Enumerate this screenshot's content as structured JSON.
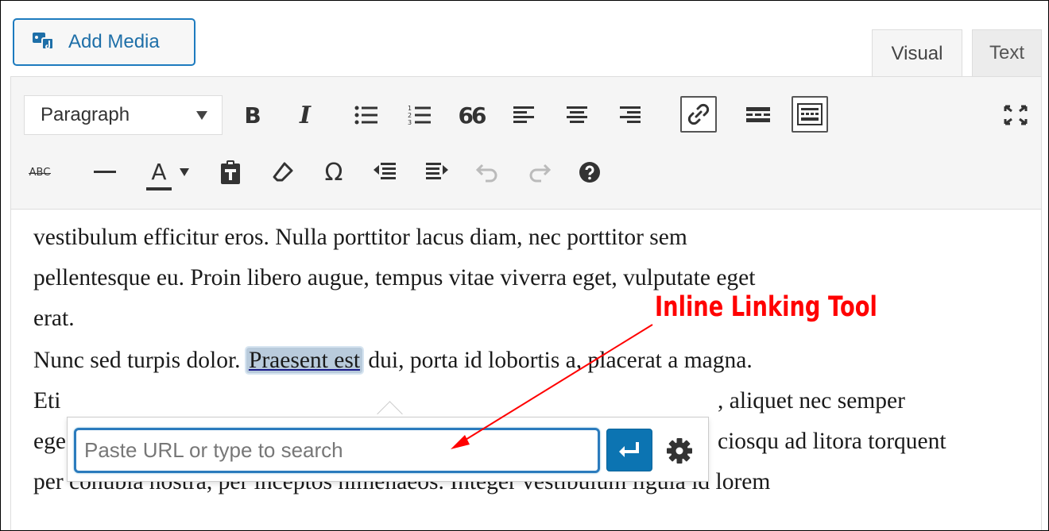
{
  "editor": {
    "add_media_label": "Add Media",
    "tabs": [
      {
        "label": "Visual",
        "active": true
      },
      {
        "label": "Text",
        "active": false
      }
    ]
  },
  "toolbar": {
    "format_select_value": "Paragraph",
    "row1_icons": [
      "bold-icon",
      "italic-icon",
      "bulleted-list-icon",
      "numbered-list-icon",
      "blockquote-icon",
      "align-left-icon",
      "align-center-icon",
      "align-right-icon",
      "insert-link-icon",
      "read-more-icon",
      "toolbar-toggle-icon",
      "fullscreen-icon"
    ],
    "row2_icons": [
      "strikethrough-icon",
      "horizontal-line-icon",
      "text-color-icon",
      "paste-as-text-icon",
      "clear-formatting-icon",
      "special-character-icon",
      "decrease-indent-icon",
      "increase-indent-icon",
      "undo-icon",
      "redo-icon",
      "help-icon"
    ],
    "bold_glyph": "B",
    "italic_glyph": "I",
    "blockquote_glyph": "66",
    "text_color_glyph": "A",
    "special_char_glyph": "Ω",
    "strike_glyph": "ABC"
  },
  "content": {
    "paragraph1_lines": [
      "vestibulum efficitur eros. Nulla porttitor lacus diam, nec porttitor sem",
      "pellentesque eu. Proin libero augue, tempus vitae viverra eget, vulputate eget",
      "erat."
    ],
    "paragraph2": {
      "line1_before": "Nunc sed turpis dolor. ",
      "line1_selected": "Praesent est",
      "line1_after": " dui, porta id lobortis a, placerat a magna.",
      "line2_start": "Eti",
      "line2_end": ", aliquet nec semper",
      "line3_start": "ege",
      "line3_end": "ciosqu ad litora torquent",
      "line4": "per conubia nostra, per inceptos himenaeos. Integer vestibulum ligula id lorem"
    }
  },
  "link_popup": {
    "url_placeholder": "Paste URL or type to search",
    "url_value": "",
    "apply_icon": "enter-arrow-icon",
    "settings_icon": "gear-icon"
  },
  "annotation": {
    "label": "Inline Linking Tool",
    "color": "#ff0000"
  },
  "colors": {
    "accent": "#0c74b2",
    "selection": "#b9cbdc",
    "toolbar_bg": "#f5f5f5"
  }
}
